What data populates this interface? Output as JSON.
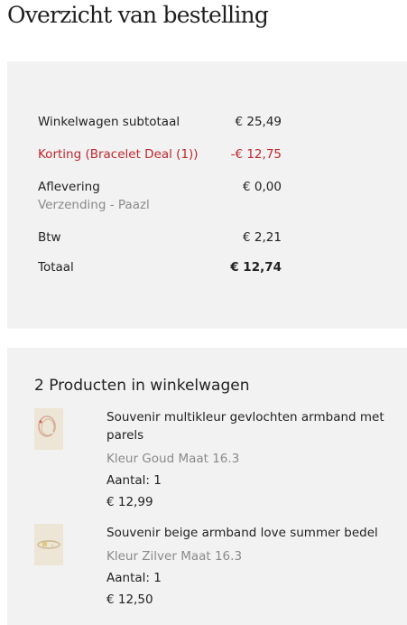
{
  "page": {
    "title": "Overzicht van bestelling"
  },
  "summary": {
    "subtotal": {
      "label": "Winkelwagen subtotaal",
      "value": "€ 25,49"
    },
    "discount": {
      "label": "Korting (Bracelet Deal (1))",
      "value": "-€ 12,75"
    },
    "shipping": {
      "label": "Aflevering",
      "value": "€ 0,00",
      "method": "Verzending - Paazl"
    },
    "tax": {
      "label": "Btw",
      "value": "€ 2,21"
    },
    "total": {
      "label": "Totaal",
      "value": "€ 12,74"
    }
  },
  "cart": {
    "title": "2 Producten in winkelwagen",
    "items": [
      {
        "name": "Souvenir multikleur gevlochten armband met parels",
        "variant": "Kleur Goud Maat 16.3",
        "quantity": "Aantal: 1",
        "price": "€ 12,99"
      },
      {
        "name": "Souvenir beige armband love summer bedel",
        "variant": "Kleur Zilver Maat 16.3",
        "quantity": "Aantal: 1",
        "price": "€ 12,50"
      }
    ]
  },
  "colors": {
    "discount": "#c0272d",
    "panel": "#f2f2f2",
    "muted": "#8a8a8a"
  }
}
